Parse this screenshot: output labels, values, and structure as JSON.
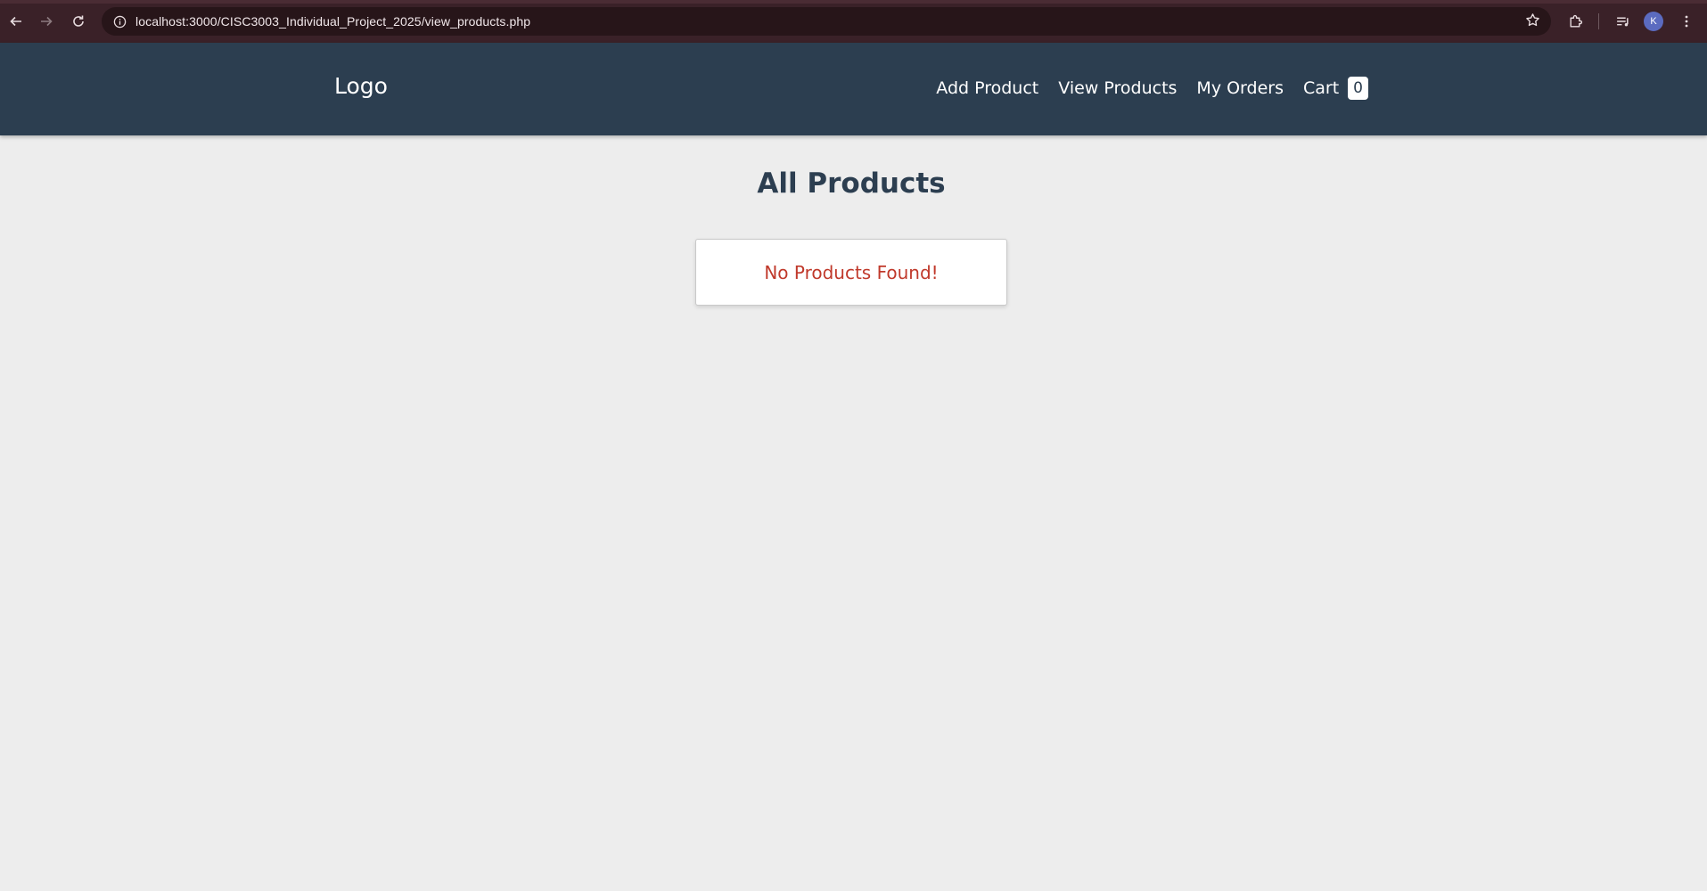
{
  "browser": {
    "url": "localhost:3000/CISC3003_Individual_Project_2025/view_products.php",
    "avatar_initial": "K",
    "icons": {
      "back": "arrow-left-icon",
      "forward": "arrow-right-icon",
      "reload": "reload-icon",
      "site_info": "info-icon",
      "bookmark": "star-icon",
      "extensions": "puzzle-icon",
      "media": "media-control-icon",
      "menu": "kebab-menu-icon"
    }
  },
  "header": {
    "logo": "Logo",
    "nav": {
      "add_product": "Add Product",
      "view_products": "View Products",
      "my_orders": "My Orders",
      "cart": "Cart",
      "cart_count": "0"
    }
  },
  "main": {
    "title": "All Products",
    "empty_message": "No Products Found!"
  },
  "colors": {
    "header_bg": "#2c3e50",
    "page_bg": "#ededed",
    "error_text": "#c0392b",
    "browser_bar": "#3a2128"
  }
}
